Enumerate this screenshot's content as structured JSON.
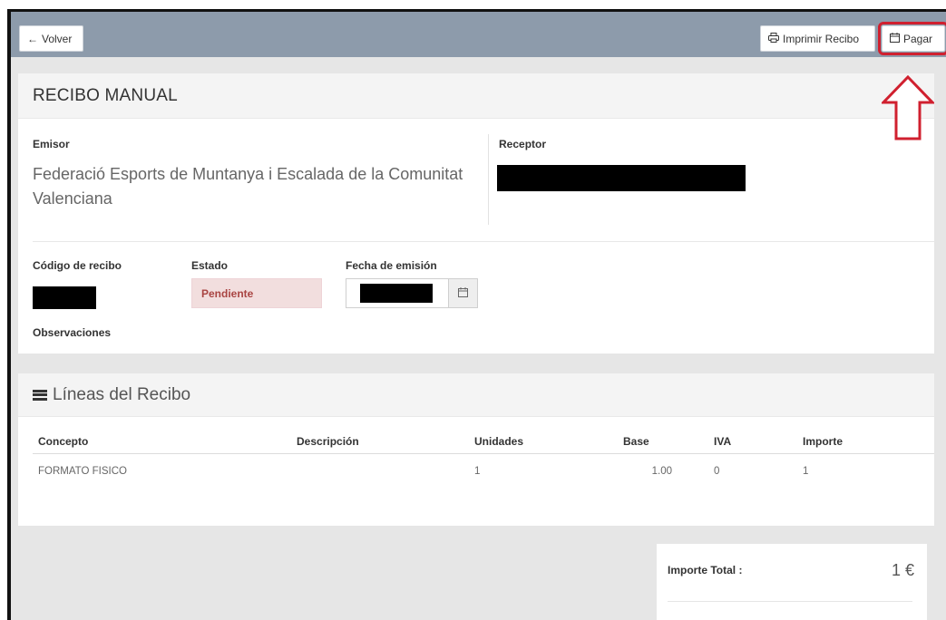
{
  "toolbar": {
    "back_label": "Volver",
    "print_label": "Imprimir Recibo",
    "pay_label": "Pagar"
  },
  "receipt": {
    "title": "RECIBO MANUAL",
    "emisor_label": "Emisor",
    "emisor_name": "Federació Esports de Muntanya i Escalada de la Comunitat Valenciana",
    "receptor_label": "Receptor",
    "codigo_label": "Código de recibo",
    "estado_label": "Estado",
    "estado_value": "Pendiente",
    "fecha_label": "Fecha de emisión",
    "observaciones_label": "Observaciones"
  },
  "lines": {
    "title": "Líneas del Recibo",
    "columns": [
      "Concepto",
      "Descripción",
      "Unidades",
      "Base",
      "IVA",
      "Importe"
    ],
    "rows": [
      {
        "concepto": "FORMATO FISICO",
        "descripcion": "",
        "unidades": "1",
        "base": "1.00",
        "iva": "0",
        "importe": "1"
      }
    ]
  },
  "total": {
    "label": "Importe Total :",
    "value": "1 €"
  },
  "colors": {
    "topbar": "#8d9bab",
    "highlight": "#d0202f",
    "estado_bg": "#f2dede",
    "estado_text": "#a94442"
  }
}
